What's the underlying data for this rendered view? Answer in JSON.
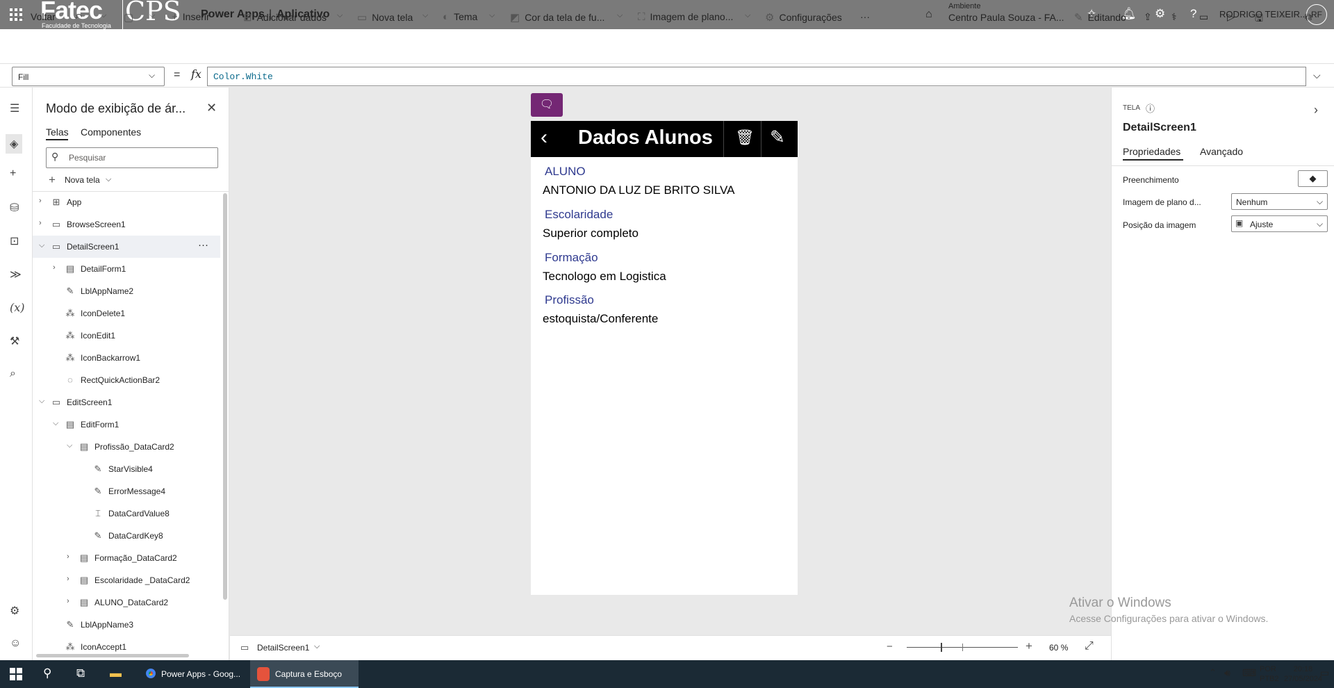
{
  "topbar": {
    "logo_text": "Fatec",
    "logo_subtext": "Faculdade de Tecnologia",
    "logo_cps": "CPS",
    "app_title": "Power Apps",
    "separator": "|",
    "app_subtitle": "Aplicativo",
    "environment_label": "Ambiente",
    "environment_name": "Centro Paula Souza - FA...",
    "user_name": "RODRIGO TEIXEIR...",
    "avatar_initials": "RF"
  },
  "toolbar": {
    "back": "Voltar",
    "insert": "Inserir",
    "add_data": "Adicionar dados",
    "new_screen": "Nova tela",
    "theme": "Tema",
    "bg_color": "Cor da tela de fu...",
    "bg_image": "Imagem de plano...",
    "settings": "Configurações",
    "more": "···",
    "editing": "Editando"
  },
  "formula_bar": {
    "property": "Fill",
    "equals": "=",
    "fx": "fx",
    "formula": "Color.White"
  },
  "tree_view": {
    "title": "Modo de exibição de ár...",
    "tabs": [
      "Telas",
      "Componentes"
    ],
    "search_placeholder": "Pesquisar",
    "new_screen": "Nova tela",
    "items": [
      {
        "label": "App"
      },
      {
        "label": "BrowseScreen1"
      },
      {
        "label": "DetailScreen1",
        "more": "···"
      },
      {
        "label": "DetailForm1"
      },
      {
        "label": "LblAppName2"
      },
      {
        "label": "IconDelete1"
      },
      {
        "label": "IconEdit1"
      },
      {
        "label": "IconBackarrow1"
      },
      {
        "label": "RectQuickActionBar2"
      },
      {
        "label": "EditScreen1"
      },
      {
        "label": "EditForm1"
      },
      {
        "label": "Profissão_DataCard2"
      },
      {
        "label": "StarVisible4"
      },
      {
        "label": "ErrorMessage4"
      },
      {
        "label": "DataCardValue8"
      },
      {
        "label": "DataCardKey8"
      },
      {
        "label": "Formação_DataCard2"
      },
      {
        "label": "Escolaridade _DataCard2"
      },
      {
        "label": "ALUNO_DataCard2"
      },
      {
        "label": "LblAppName3"
      },
      {
        "label": "IconAccept1"
      }
    ]
  },
  "app_screen": {
    "header_title": "Dados Alunos",
    "fields": [
      {
        "key": "ALUNO",
        "value": "ANTONIO DA LUZ DE BRITO SILVA"
      },
      {
        "key": "Escolaridade",
        "value": "Superior completo"
      },
      {
        "key": "Formação",
        "value": "Tecnologo em Logistica"
      },
      {
        "key": "Profissão",
        "value": "estoquista/Conferente"
      }
    ]
  },
  "canvas_footer": {
    "screen_name": "DetailScreen1",
    "zoom_value": "60",
    "zoom_unit": "%"
  },
  "properties_panel": {
    "kind": "TELA",
    "name": "DetailScreen1",
    "tabs": [
      "Propriedades",
      "Avançado"
    ],
    "fill_label": "Preenchimento",
    "bg_image_label": "Imagem de plano d...",
    "bg_image_value": "Nenhum",
    "image_position_label": "Posição da imagem",
    "image_position_value": "Ajuste"
  },
  "watermark": {
    "line1": "Ativar o Windows",
    "line2": "Acesse Configurações para ativar o Windows."
  },
  "taskbar": {
    "chrome_app": "Power Apps - Goog...",
    "snip_app": "Captura e Esboço",
    "lang1": "POR",
    "lang2": "PTB2",
    "time": "20:18",
    "date": "27/05/2024"
  }
}
